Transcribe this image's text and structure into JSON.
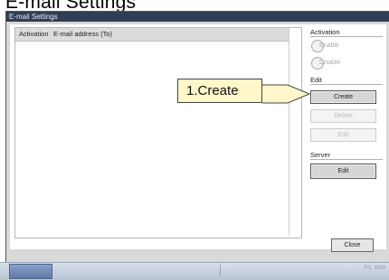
{
  "page_title": "E-mail Settings",
  "window": {
    "title": "E-mail Settings"
  },
  "list": {
    "columns": [
      "Activation",
      "E-mail address (To)"
    ]
  },
  "activation_group": {
    "label": "Activation",
    "enable_label": "Enable",
    "disable_label": "Disable"
  },
  "edit_group": {
    "label": "Edit",
    "create_label": "Create",
    "delete_label": "Delete",
    "edit_label": "Edit"
  },
  "server_group": {
    "label": "Server",
    "edit_label": "Edit"
  },
  "close_label": "Close",
  "callout": {
    "text": "1.Create"
  },
  "taskbar": {
    "date_text": "Fri, 10/0"
  },
  "colors": {
    "titlebar": "#2f3d55",
    "callout_bg": "#fff6c9",
    "panel_bg": "#d9d9d9"
  }
}
